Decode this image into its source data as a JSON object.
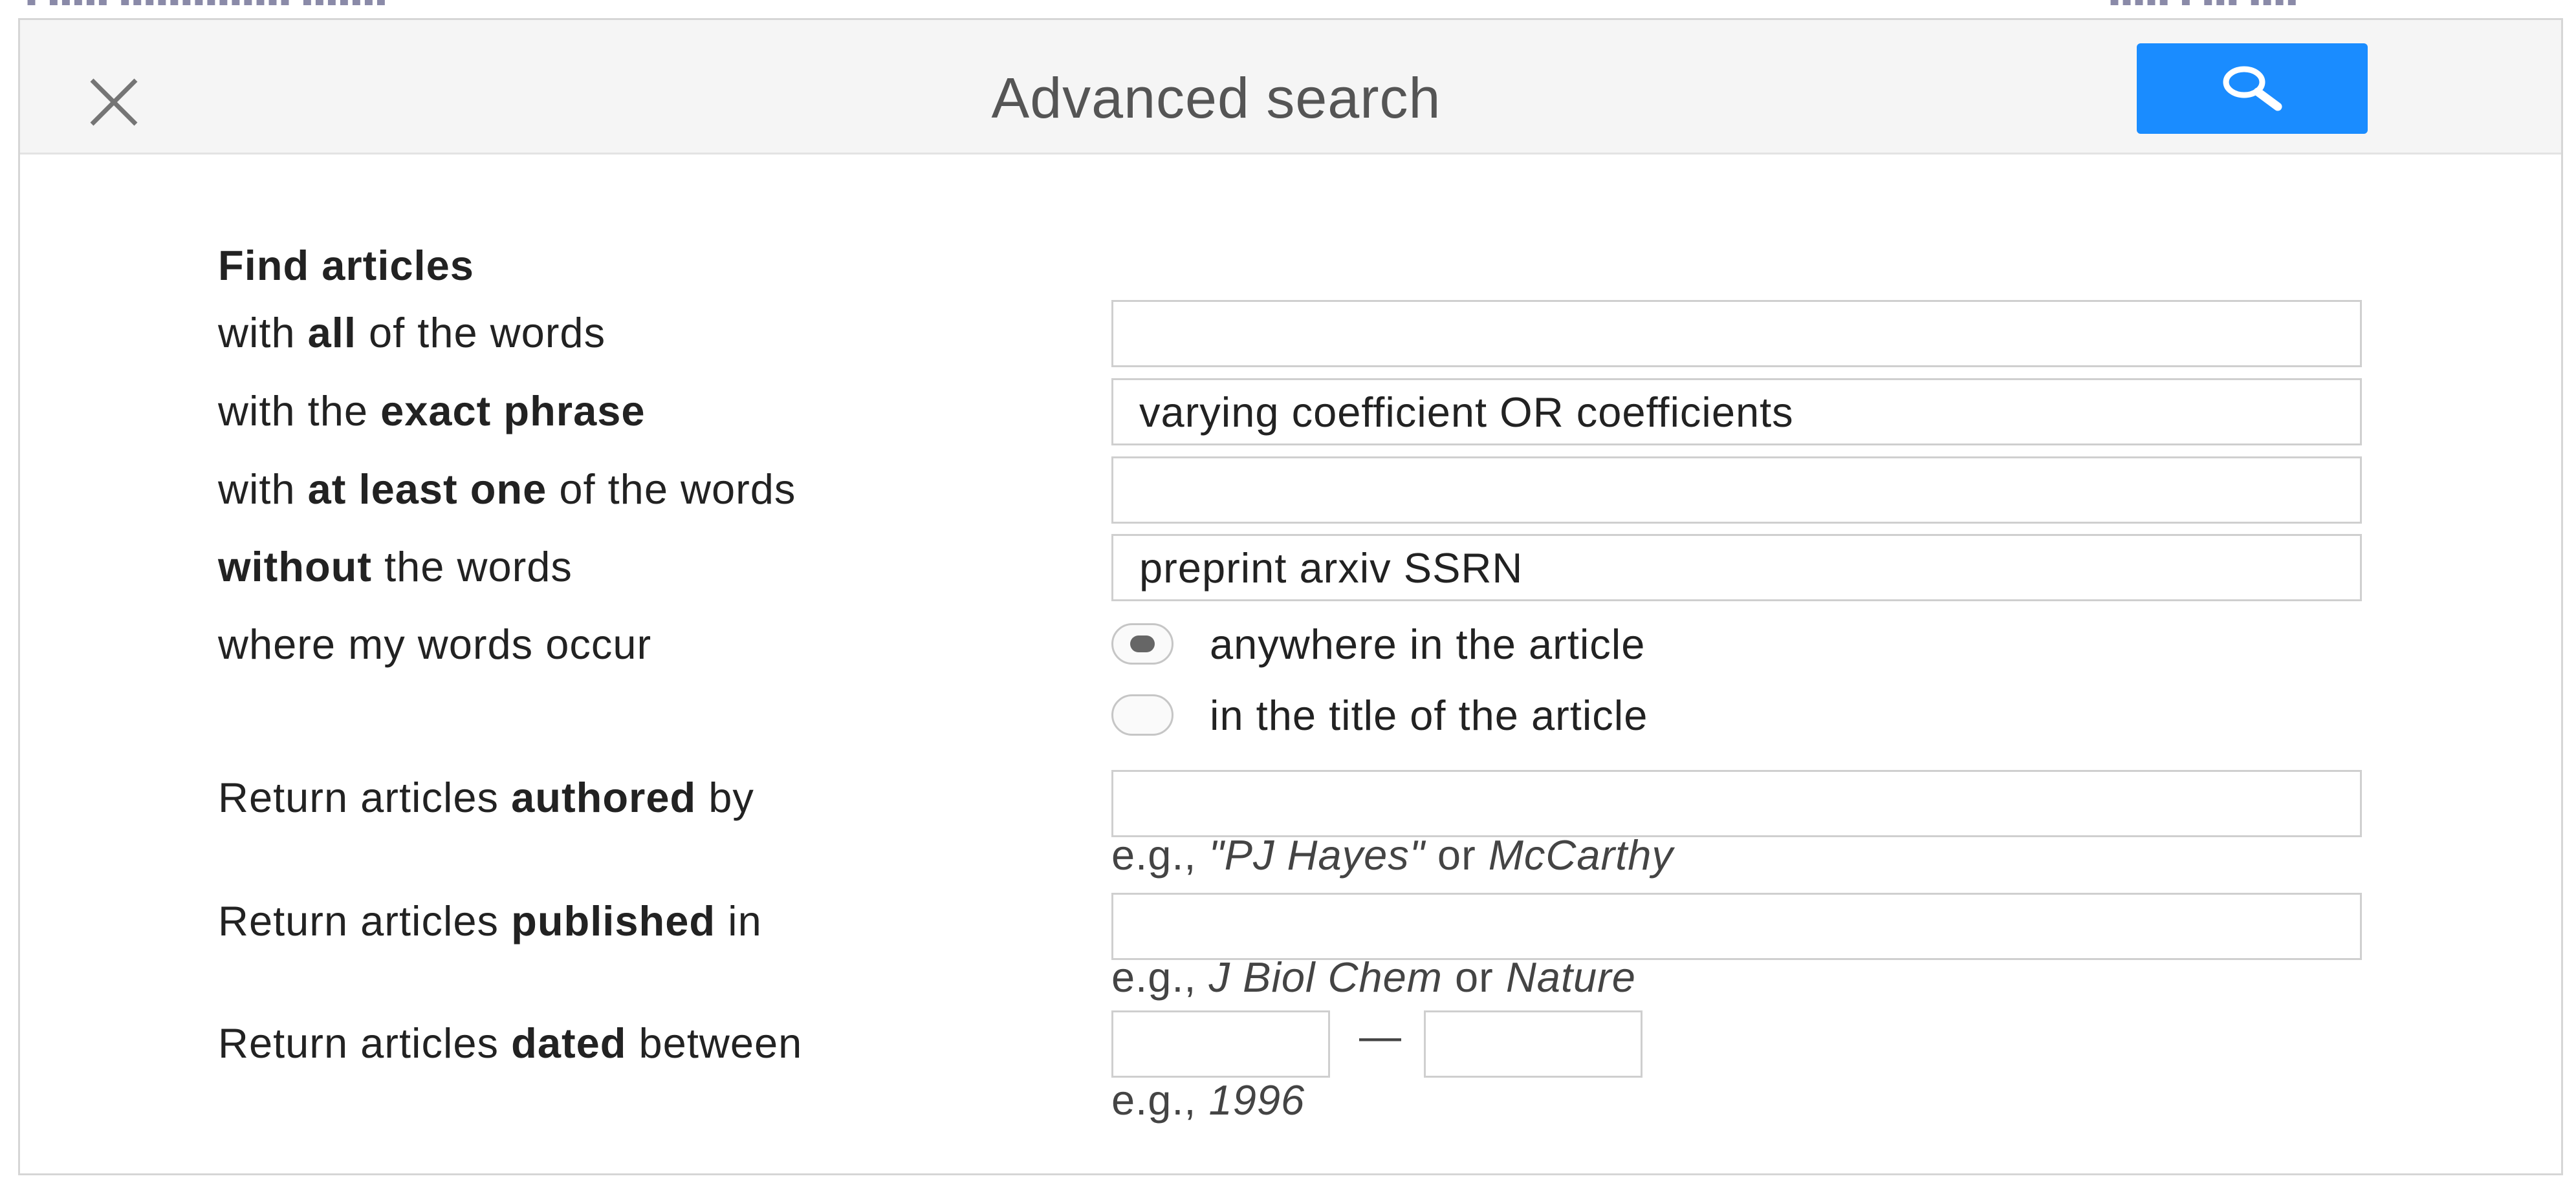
{
  "dialog": {
    "title": "Advanced search",
    "close_icon": "close-icon",
    "search_icon": "search-icon",
    "accent_color": "#1a8cff"
  },
  "form": {
    "section_heading": "Find articles",
    "all_words": {
      "label_pre": "with ",
      "label_bold": "all",
      "label_post": " of the words",
      "value": ""
    },
    "exact_phrase": {
      "label_pre": "with the ",
      "label_bold": "exact phrase",
      "label_post": "",
      "value": "varying coefficient OR coefficients"
    },
    "at_least_one": {
      "label_pre": "with ",
      "label_bold": "at least one",
      "label_post": " of the words",
      "value": ""
    },
    "without": {
      "label_pre": "",
      "label_bold": "without",
      "label_post": " the words",
      "value": "preprint arxiv SSRN"
    },
    "occur": {
      "label": "where my words occur",
      "options": [
        "anywhere in the article",
        "in the title of the article"
      ],
      "selected": "anywhere in the article"
    },
    "authored": {
      "label_pre": "Return articles ",
      "label_bold": "authored",
      "label_post": " by",
      "value": "",
      "hint_pre": "e.g., ",
      "hint_ex1": "\"PJ Hayes\"",
      "hint_mid": " or ",
      "hint_ex2": "McCarthy"
    },
    "published": {
      "label_pre": "Return articles ",
      "label_bold": "published",
      "label_post": " in",
      "value": "",
      "hint_pre": "e.g., ",
      "hint_ex1": "J Biol Chem",
      "hint_mid": " or ",
      "hint_ex2": "Nature"
    },
    "dated": {
      "label_pre": "Return articles ",
      "label_bold": "dated",
      "label_post": " between",
      "from_value": "",
      "to_value": "",
      "separator": "—",
      "hint_pre": "e.g., ",
      "hint_ex": "1996"
    }
  }
}
